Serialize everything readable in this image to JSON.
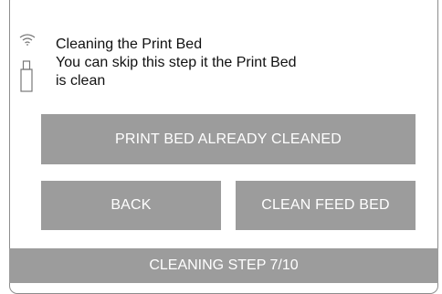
{
  "icons": {
    "wifi": "wifi-icon",
    "usb": "usb-drive-icon"
  },
  "message": {
    "title": "Cleaning the Print Bed",
    "line2": "You can skip this step it the Print Bed",
    "line3": "is clean"
  },
  "buttons": {
    "skip_label": "PRINT BED ALREADY CLEANED",
    "back_label": "BACK",
    "clean_label": "CLEAN FEED BED"
  },
  "footer": {
    "status": "CLEANING STEP 7/10"
  },
  "colors": {
    "button_bg": "#9c9c9c",
    "button_text": "#ffffff",
    "frame_border": "#8d8d8d"
  }
}
